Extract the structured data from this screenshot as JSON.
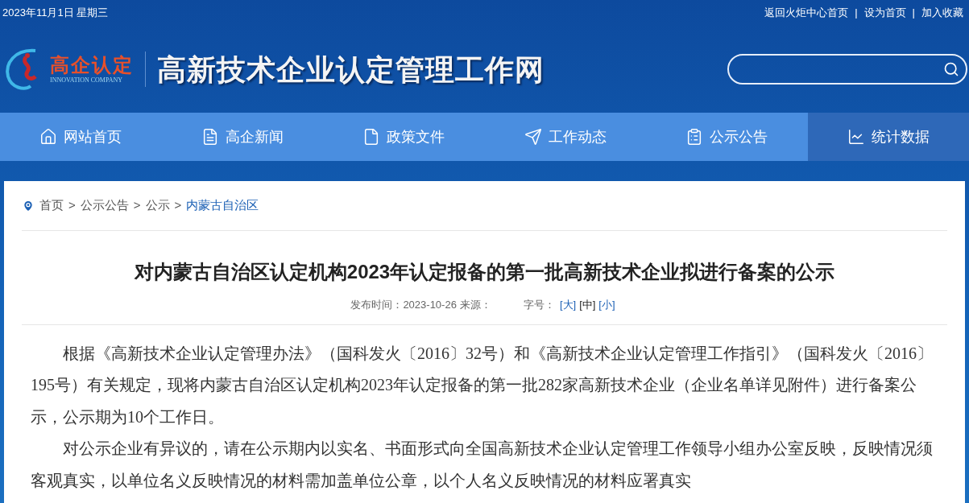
{
  "top_bar": {
    "date": "2023年11月1日 星期三",
    "links": [
      "返回火炬中心首页",
      "设为首页",
      "加入收藏"
    ],
    "separator": "|"
  },
  "header": {
    "logo_text": "高企认定",
    "logo_subtext": "INNOVATION COMPANY",
    "site_title": "高新技术企业认定管理工作网"
  },
  "nav": [
    {
      "label": "网站首页",
      "selected": false
    },
    {
      "label": "高企新闻",
      "selected": false
    },
    {
      "label": "政策文件",
      "selected": false
    },
    {
      "label": "工作动态",
      "selected": false
    },
    {
      "label": "公示公告",
      "selected": false
    },
    {
      "label": "统计数据",
      "selected": true
    }
  ],
  "breadcrumb": {
    "separator": ">",
    "items": [
      {
        "label": "首页",
        "current": false
      },
      {
        "label": "公示公告",
        "current": false
      },
      {
        "label": "公示",
        "current": false
      },
      {
        "label": "内蒙古自治区",
        "current": true
      }
    ]
  },
  "article": {
    "title": "对内蒙古自治区认定机构2023年认定报备的第一批高新技术企业拟进行备案的公示",
    "meta": {
      "published": "发布时间：2023-10-26",
      "source": "来源：",
      "font_size_label": "字号：",
      "font_sizes": [
        {
          "label": "[大]",
          "selected": false
        },
        {
          "label": "[中]",
          "selected": true
        },
        {
          "label": "[小]",
          "selected": false
        }
      ]
    },
    "paragraphs": [
      "根据《高新技术企业认定管理办法》（国科发火〔2016〕32号）和《高新技术企业认定管理工作指引》（国科发火〔2016〕195号）有关规定，现将内蒙古自治区认定机构2023年认定报备的第一批282家高新技术企业（企业名单详见附件）进行备案公示，公示期为10个工作日。",
      "对公示企业有异议的，请在公示期内以实名、书面形式向全国高新技术企业认定管理工作领导小组办公室反映，反映情况须客观真实，以单位名义反映情况的材料需加盖单位公章，以个人名义反映情况的材料应署真实"
    ]
  }
}
